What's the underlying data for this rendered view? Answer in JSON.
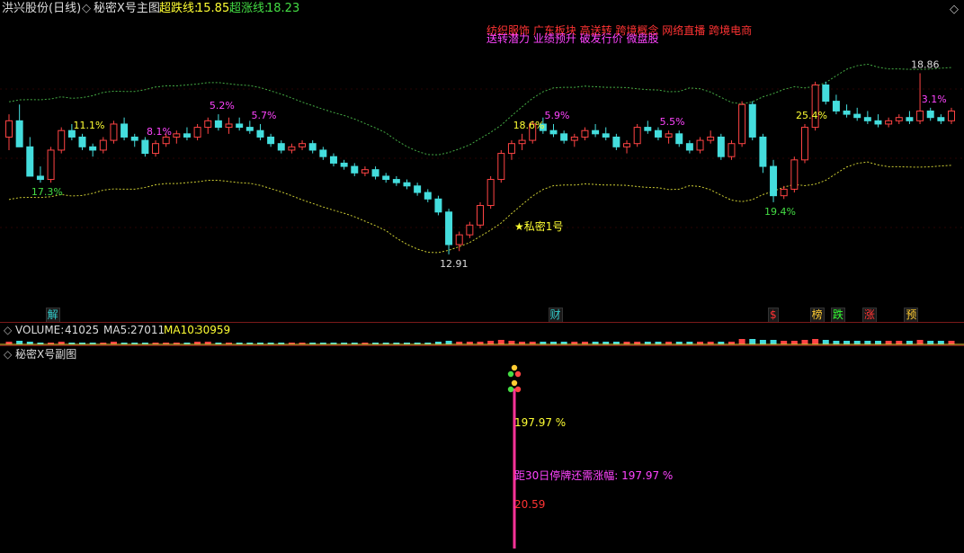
{
  "main_panel": {
    "stock": "洪兴股份(日线)",
    "indicator": "秘密X号主图",
    "lower_label": "超跌线:",
    "lower_value": "15.85",
    "upper_label": "超涨线:",
    "upper_value": "18.23",
    "concepts_line1": "纺织服饰 广东板块 高送转 跨境概念 网络直播 跨境电商",
    "concepts_line2": "送转潜力 业绩预升 破发行价 微盘股",
    "signal_label": "★私密1号"
  },
  "volume_panel": {
    "label": "VOLUME:",
    "value": "41025",
    "ma5_label": "MA5:",
    "ma5": "27011",
    "ma10_label": "MA10:",
    "ma10": "30959"
  },
  "sub_panel": {
    "title": "秘密X号副图",
    "pct_label": "197.97 %",
    "distance_text": "距30日停牌还需涨幅: 197.97 %",
    "price_label": "20.59"
  },
  "event_markers": [
    {
      "label": "解",
      "color": "#33cccc"
    },
    {
      "label": "财",
      "color": "#33cccc"
    },
    {
      "label": "$",
      "color": "#ff3333"
    },
    {
      "label": "榜",
      "color": "#ffcc33"
    },
    {
      "label": "跌",
      "color": "#33ff33"
    },
    {
      "label": "涨",
      "color": "#ff3333"
    },
    {
      "label": "预",
      "color": "#ffcc33"
    }
  ],
  "chart_data": {
    "type": "candlestick",
    "series": [
      {
        "name": "K线",
        "values": [
          [
            16.9,
            17.6,
            16.5,
            17.4
          ],
          [
            17.4,
            17.9,
            17.0,
            16.6
          ],
          [
            16.6,
            16.9,
            16.4,
            15.7
          ],
          [
            15.7,
            16.0,
            15.5,
            15.6
          ],
          [
            15.6,
            16.6,
            15.5,
            16.5
          ],
          [
            16.5,
            17.2,
            16.4,
            17.1
          ],
          [
            17.1,
            17.3,
            16.8,
            16.9
          ],
          [
            16.9,
            17.0,
            16.5,
            16.6
          ],
          [
            16.6,
            16.7,
            16.3,
            16.5
          ],
          [
            16.5,
            16.9,
            16.4,
            16.8
          ],
          [
            16.8,
            17.4,
            16.7,
            17.3
          ],
          [
            17.3,
            17.5,
            16.8,
            16.9
          ],
          [
            16.9,
            17.0,
            16.6,
            16.8
          ],
          [
            16.8,
            16.9,
            16.3,
            16.4
          ],
          [
            16.4,
            16.8,
            16.3,
            16.7
          ],
          [
            16.7,
            17.0,
            16.6,
            16.9
          ],
          [
            16.9,
            17.1,
            16.7,
            17.0
          ],
          [
            17.0,
            17.2,
            16.8,
            16.9
          ],
          [
            16.9,
            17.3,
            16.8,
            17.2
          ],
          [
            17.2,
            17.5,
            17.0,
            17.4
          ],
          [
            17.4,
            17.6,
            17.1,
            17.2
          ],
          [
            17.2,
            17.5,
            17.0,
            17.3
          ],
          [
            17.3,
            17.5,
            17.1,
            17.2
          ],
          [
            17.2,
            17.4,
            17.0,
            17.1
          ],
          [
            17.1,
            17.3,
            16.8,
            16.9
          ],
          [
            16.9,
            17.0,
            16.6,
            16.7
          ],
          [
            16.7,
            16.8,
            16.4,
            16.5
          ],
          [
            16.5,
            16.7,
            16.4,
            16.6
          ],
          [
            16.6,
            16.8,
            16.5,
            16.7
          ],
          [
            16.7,
            16.8,
            16.4,
            16.5
          ],
          [
            16.5,
            16.6,
            16.2,
            16.3
          ],
          [
            16.3,
            16.4,
            16.0,
            16.1
          ],
          [
            16.1,
            16.2,
            15.9,
            16.0
          ],
          [
            16.0,
            16.1,
            15.7,
            15.8
          ],
          [
            15.8,
            16.0,
            15.7,
            15.9
          ],
          [
            15.9,
            16.0,
            15.6,
            15.7
          ],
          [
            15.7,
            15.8,
            15.5,
            15.6
          ],
          [
            15.6,
            15.7,
            15.4,
            15.5
          ],
          [
            15.5,
            15.6,
            15.3,
            15.4
          ],
          [
            15.4,
            15.5,
            15.1,
            15.2
          ],
          [
            15.2,
            15.3,
            14.9,
            15.0
          ],
          [
            15.0,
            15.1,
            14.5,
            14.6
          ],
          [
            14.6,
            14.7,
            13.3,
            13.6
          ],
          [
            13.6,
            14.0,
            13.4,
            13.9
          ],
          [
            13.9,
            14.3,
            13.8,
            14.2
          ],
          [
            14.2,
            14.9,
            14.1,
            14.8
          ],
          [
            14.8,
            15.7,
            14.7,
            15.6
          ],
          [
            15.6,
            16.5,
            15.5,
            16.4
          ],
          [
            16.4,
            16.8,
            16.2,
            16.7
          ],
          [
            16.7,
            17.0,
            16.5,
            16.8
          ],
          [
            16.8,
            17.4,
            16.7,
            17.3
          ],
          [
            17.3,
            17.5,
            17.0,
            17.1
          ],
          [
            17.1,
            17.3,
            16.9,
            17.0
          ],
          [
            17.0,
            17.1,
            16.7,
            16.8
          ],
          [
            16.8,
            17.0,
            16.6,
            16.9
          ],
          [
            16.9,
            17.2,
            16.8,
            17.1
          ],
          [
            17.1,
            17.3,
            16.9,
            17.0
          ],
          [
            17.0,
            17.2,
            16.8,
            16.9
          ],
          [
            16.9,
            17.0,
            16.5,
            16.6
          ],
          [
            16.6,
            16.8,
            16.4,
            16.7
          ],
          [
            16.7,
            17.3,
            16.6,
            17.2
          ],
          [
            17.2,
            17.4,
            17.0,
            17.1
          ],
          [
            17.1,
            17.2,
            16.8,
            16.9
          ],
          [
            16.9,
            17.1,
            16.7,
            17.0
          ],
          [
            17.0,
            17.1,
            16.6,
            16.7
          ],
          [
            16.7,
            16.8,
            16.4,
            16.5
          ],
          [
            16.5,
            16.9,
            16.4,
            16.8
          ],
          [
            16.8,
            17.1,
            16.7,
            16.9
          ],
          [
            16.9,
            17.0,
            16.2,
            16.3
          ],
          [
            16.3,
            16.8,
            16.2,
            16.7
          ],
          [
            16.7,
            18.0,
            16.6,
            17.9
          ],
          [
            17.9,
            18.0,
            16.8,
            16.9
          ],
          [
            16.9,
            17.0,
            15.8,
            16.0
          ],
          [
            16.0,
            16.2,
            14.9,
            15.1
          ],
          [
            15.1,
            15.4,
            15.0,
            15.3
          ],
          [
            15.3,
            16.3,
            15.2,
            16.2
          ],
          [
            16.2,
            17.3,
            16.1,
            17.2
          ],
          [
            17.2,
            18.6,
            17.1,
            18.5
          ],
          [
            18.5,
            18.6,
            17.9,
            18.0
          ],
          [
            18.0,
            18.2,
            17.6,
            17.7
          ],
          [
            17.7,
            17.9,
            17.5,
            17.6
          ],
          [
            17.6,
            17.8,
            17.4,
            17.5
          ],
          [
            17.5,
            17.7,
            17.3,
            17.4
          ],
          [
            17.4,
            17.6,
            17.2,
            17.3
          ],
          [
            17.3,
            17.5,
            17.2,
            17.4
          ],
          [
            17.4,
            17.6,
            17.3,
            17.5
          ],
          [
            17.5,
            17.7,
            17.3,
            17.4
          ],
          [
            17.4,
            18.86,
            17.3,
            17.7
          ],
          [
            17.7,
            17.8,
            17.4,
            17.5
          ],
          [
            17.5,
            17.6,
            17.3,
            17.4
          ],
          [
            17.4,
            17.8,
            17.3,
            17.7
          ]
        ]
      }
    ],
    "annotations": [
      "17.3%",
      "11.1%",
      "8.1%",
      "5.2%",
      "5.7%",
      "12.91",
      "18.6%",
      "5.9%",
      "5.5%",
      "25.4%",
      "19.4%",
      "18.86",
      "3.1%"
    ],
    "volume": {
      "values": [
        3,
        4,
        3,
        2,
        2,
        3,
        2,
        2,
        2,
        2,
        3,
        2,
        2,
        2,
        2,
        2,
        2,
        2,
        3,
        3,
        2,
        2,
        2,
        2,
        2,
        2,
        2,
        2,
        2,
        2,
        2,
        2,
        2,
        2,
        2,
        2,
        2,
        2,
        2,
        2,
        2,
        3,
        4,
        3,
        3,
        3,
        4,
        5,
        4,
        3,
        3,
        3,
        3,
        3,
        3,
        3,
        3,
        3,
        3,
        3,
        3,
        3,
        3,
        3,
        3,
        3,
        3,
        3,
        3,
        3,
        6,
        6,
        5,
        5,
        4,
        4,
        5,
        6,
        5,
        4,
        4,
        4,
        4,
        4,
        4,
        4,
        4,
        5,
        4,
        4,
        4
      ]
    },
    "sub_series": {
      "values": [
        0,
        0,
        0,
        0,
        0,
        0,
        0,
        0,
        0,
        0,
        0,
        0,
        0,
        0,
        0,
        0,
        0,
        0,
        0,
        0,
        0,
        0,
        0,
        0,
        0,
        0,
        0,
        0,
        0,
        0,
        0,
        0,
        0,
        0,
        0,
        0,
        0,
        0,
        0,
        0,
        0,
        0,
        0,
        0,
        0,
        197.97,
        0,
        0,
        0,
        0,
        0,
        0,
        0,
        0,
        0,
        0,
        0,
        0,
        0,
        0,
        0,
        0,
        0,
        0,
        0,
        0,
        0,
        0,
        0,
        0,
        0,
        0,
        0,
        0,
        0,
        0,
        0,
        0,
        0,
        0,
        0,
        0,
        0,
        0,
        0,
        0,
        0,
        0,
        0,
        0,
        0
      ]
    }
  }
}
